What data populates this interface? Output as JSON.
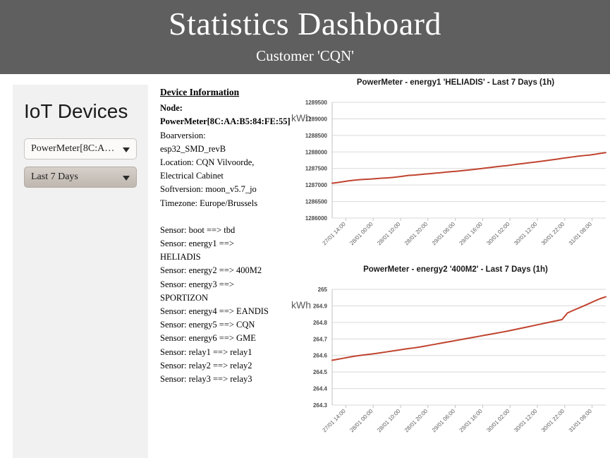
{
  "header": {
    "title": "Statistics Dashboard",
    "subtitle": "Customer 'CQN'",
    "background": "#5f5f5f"
  },
  "sidebar": {
    "title": "IoT Devices",
    "device_select": {
      "value": "PowerMeter[8C:AA:...",
      "icon": "chevron-down-icon"
    },
    "range_select": {
      "value": "Last 7 Days",
      "icon": "chevron-down-icon"
    }
  },
  "device_info": {
    "heading": "Device Information",
    "node_label": "Node:",
    "node_value": "PowerMeter[8C:AA:B5:84:FE:55]",
    "boardversion": "Boarversion: esp32_SMD_revB",
    "location": "Location: CQN Vilvoorde, Electrical Cabinet",
    "softversion": "Softversion: moon_v5.7_jo",
    "timezone": "Timezone: Europe/Brussels",
    "sensors": [
      "Sensor: boot ==> tbd",
      "Sensor: energy1 ==> HELIADIS",
      "Sensor: energy2 ==> 400M2",
      "Sensor: energy3 ==> SPORTIZON",
      "Sensor: energy4 ==> EANDIS",
      "Sensor: energy5 ==> CQN",
      "Sensor: energy6 ==> GME",
      "Sensor: relay1 ==> relay1",
      "Sensor: relay2 ==> relay2",
      "Sensor: relay3 ==> relay3"
    ]
  },
  "chart_data": [
    {
      "type": "line",
      "title": "PowerMeter - energy1 'HELIADIS' - Last 7 Days (1h)",
      "xlabel": "",
      "ylabel": "kWh",
      "ylim": [
        1286000,
        1289500
      ],
      "yticks": [
        1286000,
        1286500,
        1287000,
        1287500,
        1288000,
        1288500,
        1289000,
        1289500
      ],
      "grid": true,
      "legend": "none",
      "line_color": "#c0442f",
      "xticks": [
        "27/01 14:00",
        "28/01 00:00",
        "28/01 10:00",
        "28/01 20:00",
        "29/01 06:00",
        "29/01 16:00",
        "30/01 02:00",
        "30/01 12:00",
        "30/01 22:00",
        "31/01 08:00"
      ],
      "x": [
        0,
        2,
        4,
        6,
        8,
        10,
        12,
        14,
        16,
        18,
        20,
        22,
        24,
        26,
        28,
        30,
        32,
        34,
        36,
        38,
        40,
        42,
        44,
        46,
        48,
        50,
        52,
        54,
        56,
        58,
        60,
        62,
        64,
        66,
        68,
        70,
        72,
        74,
        76,
        78,
        80,
        82,
        84,
        86,
        88,
        90,
        92,
        94,
        96,
        98,
        100
      ],
      "values": [
        1287055,
        1287075,
        1287100,
        1287125,
        1287145,
        1287160,
        1287172,
        1287180,
        1287192,
        1287205,
        1287215,
        1287228,
        1287245,
        1287268,
        1287290,
        1287300,
        1287315,
        1287330,
        1287345,
        1287360,
        1287375,
        1287392,
        1287405,
        1287420,
        1287438,
        1287455,
        1287472,
        1287492,
        1287512,
        1287532,
        1287552,
        1287570,
        1287588,
        1287610,
        1287632,
        1287652,
        1287672,
        1287692,
        1287712,
        1287735,
        1287758,
        1287780,
        1287805,
        1287828,
        1287850,
        1287872,
        1287890,
        1287905,
        1287928,
        1287955,
        1287978
      ]
    },
    {
      "type": "line",
      "title": "PowerMeter - energy2 '400M2' - Last 7 Days (1h)",
      "xlabel": "",
      "ylabel": "kWh",
      "ylim": [
        264.3,
        265
      ],
      "yticks": [
        264.3,
        264.4,
        264.5,
        264.6,
        264.7,
        264.8,
        264.9,
        265
      ],
      "grid": true,
      "legend": "none",
      "line_color": "#c0442f",
      "xticks": [
        "27/01 14:00",
        "28/01 00:00",
        "28/01 10:00",
        "28/01 20:00",
        "29/01 06:00",
        "29/01 16:00",
        "30/01 02:00",
        "30/01 12:00",
        "30/01 22:00",
        "31/01 08:00"
      ],
      "x": [
        0,
        2,
        4,
        6,
        8,
        10,
        12,
        14,
        16,
        18,
        20,
        22,
        24,
        26,
        28,
        30,
        32,
        34,
        36,
        38,
        40,
        42,
        44,
        46,
        48,
        50,
        52,
        54,
        56,
        58,
        60,
        62,
        64,
        66,
        68,
        70,
        72,
        74,
        76,
        78,
        80,
        82,
        84,
        86,
        88,
        90,
        92,
        94,
        96,
        98,
        100
      ],
      "values": [
        264.571,
        264.577,
        264.583,
        264.589,
        264.595,
        264.6,
        264.604,
        264.608,
        264.612,
        264.617,
        264.622,
        264.627,
        264.632,
        264.637,
        264.642,
        264.646,
        264.651,
        264.657,
        264.663,
        264.669,
        264.675,
        264.681,
        264.687,
        264.693,
        264.699,
        264.705,
        264.711,
        264.717,
        264.723,
        264.729,
        264.735,
        264.741,
        264.747,
        264.754,
        264.761,
        264.768,
        264.775,
        264.782,
        264.789,
        264.796,
        264.803,
        264.81,
        264.817,
        264.857,
        264.872,
        264.886,
        264.9,
        264.915,
        264.93,
        264.944,
        264.955
      ]
    }
  ]
}
